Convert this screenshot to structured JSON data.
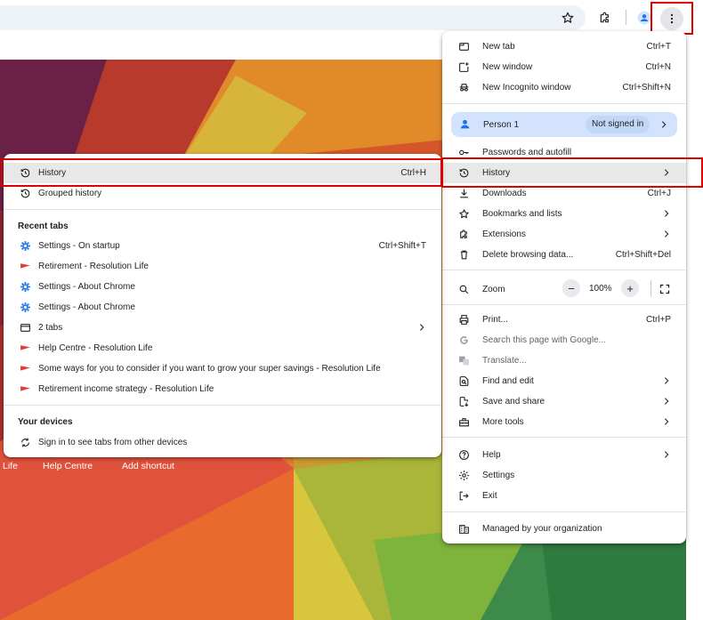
{
  "colors": {
    "highlight_red": "#e00000",
    "person_pill": "#d3e3fd",
    "settings_blue": "#1a73e8",
    "resolution_red": "#e53935"
  },
  "toolbar": {
    "icons": [
      "star-icon",
      "extensions-icon",
      "profile-icon",
      "more-vert-icon"
    ]
  },
  "ntp": {
    "shortcuts": [
      "Life",
      "Help Centre",
      "Add shortcut"
    ]
  },
  "main_menu": {
    "new_tab": {
      "label": "New tab",
      "shortcut": "Ctrl+T"
    },
    "new_window": {
      "label": "New window",
      "shortcut": "Ctrl+N"
    },
    "incognito": {
      "label": "New Incognito window",
      "shortcut": "Ctrl+Shift+N"
    },
    "person": {
      "label": "Person 1",
      "badge": "Not signed in"
    },
    "passwords": {
      "label": "Passwords and autofill"
    },
    "history": {
      "label": "History"
    },
    "downloads": {
      "label": "Downloads",
      "shortcut": "Ctrl+J"
    },
    "bookmarks": {
      "label": "Bookmarks and lists"
    },
    "extensions": {
      "label": "Extensions"
    },
    "delete_data": {
      "label": "Delete browsing data...",
      "shortcut": "Ctrl+Shift+Del"
    },
    "zoom": {
      "label": "Zoom",
      "value": "100%",
      "minus": "−",
      "plus": "+"
    },
    "print": {
      "label": "Print...",
      "shortcut": "Ctrl+P"
    },
    "search_google": {
      "label": "Search this page with Google..."
    },
    "translate": {
      "label": "Translate..."
    },
    "find_edit": {
      "label": "Find and edit"
    },
    "save_share": {
      "label": "Save and share"
    },
    "more_tools": {
      "label": "More tools"
    },
    "help": {
      "label": "Help"
    },
    "settings": {
      "label": "Settings"
    },
    "exit": {
      "label": "Exit"
    },
    "managed": {
      "label": "Managed by your organization"
    }
  },
  "history_submenu": {
    "history": {
      "label": "History",
      "shortcut": "Ctrl+H"
    },
    "grouped": {
      "label": "Grouped history"
    },
    "recent_tabs_header": "Recent tabs",
    "recent_tabs": [
      {
        "label": "Settings - On startup",
        "shortcut": "Ctrl+Shift+T",
        "icon": "settings-gear-icon"
      },
      {
        "label": "Retirement - Resolution Life",
        "shortcut": "",
        "icon": "resolution-flag-icon"
      },
      {
        "label": "Settings - About Chrome",
        "shortcut": "",
        "icon": "settings-gear-icon"
      },
      {
        "label": "Settings - About Chrome",
        "shortcut": "",
        "icon": "settings-gear-icon"
      },
      {
        "label": "2 tabs",
        "shortcut": "",
        "icon": "window-icon"
      },
      {
        "label": "Help Centre - Resolution Life",
        "shortcut": "",
        "icon": "resolution-flag-icon"
      },
      {
        "label": "Some ways for you to consider if you want to grow your super savings - Resolution Life",
        "shortcut": "",
        "icon": "resolution-flag-icon"
      },
      {
        "label": "Retirement income strategy - Resolution Life",
        "shortcut": "",
        "icon": "resolution-flag-icon"
      }
    ],
    "devices_header": "Your devices",
    "sign_in": {
      "label": "Sign in to see tabs from other devices"
    }
  }
}
